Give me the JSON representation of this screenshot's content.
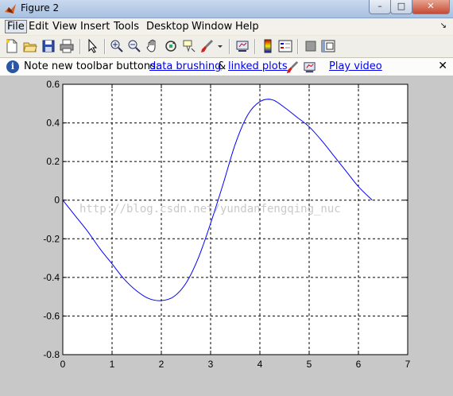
{
  "window": {
    "title": "Figure 2",
    "controls": {
      "minimize": "–",
      "maximize": "□",
      "close": "✕"
    }
  },
  "menubar": {
    "items": [
      "File",
      "Edit",
      "View",
      "Insert",
      "Tools",
      "Desktop",
      "Window",
      "Help"
    ],
    "overflow_glyph": "↘"
  },
  "toolbar": {
    "buttons": [
      "new-figure",
      "open-file",
      "save-figure",
      "print-figure",
      "edit-plot",
      "zoom-in",
      "zoom-out",
      "pan",
      "rotate-3d",
      "data-cursor",
      "brush",
      "link-plot",
      "colorbar",
      "legend",
      "hide-plot-tools",
      "show-plot-tools"
    ]
  },
  "note": {
    "prefix": "Note new toolbar buttons:",
    "link1": "data brushing",
    "amp": "&",
    "link2": "linked plots",
    "video": "Play video",
    "close": "✕"
  },
  "watermark": "http://blog.csdn.net/yundanfengqing_nuc",
  "chart_data": {
    "type": "line",
    "title": "",
    "xlabel": "",
    "ylabel": "",
    "xlim": [
      0,
      7
    ],
    "ylim": [
      -0.8,
      0.6
    ],
    "xticks": [
      "0",
      "1",
      "2",
      "3",
      "4",
      "5",
      "6",
      "7"
    ],
    "yticks": [
      "0.6",
      "0.4",
      "0.2",
      "0",
      "-0.2",
      "-0.4",
      "-0.6",
      "-0.8"
    ],
    "grid": true,
    "series": [
      {
        "color": "#0000ff",
        "x": [
          0,
          0.25,
          0.5,
          0.75,
          1.0,
          1.25,
          1.5,
          1.75,
          2.0,
          2.25,
          2.5,
          2.75,
          3.0,
          3.25,
          3.5,
          3.75,
          4.0,
          4.25,
          4.5,
          4.75,
          5.0,
          5.25,
          5.5,
          5.75,
          6.0,
          6.28
        ],
        "y": [
          0,
          -0.08,
          -0.16,
          -0.25,
          -0.33,
          -0.41,
          -0.47,
          -0.51,
          -0.52,
          -0.5,
          -0.43,
          -0.3,
          -0.12,
          0.08,
          0.29,
          0.44,
          0.51,
          0.52,
          0.48,
          0.43,
          0.38,
          0.31,
          0.23,
          0.15,
          0.07,
          0.0
        ]
      }
    ]
  }
}
